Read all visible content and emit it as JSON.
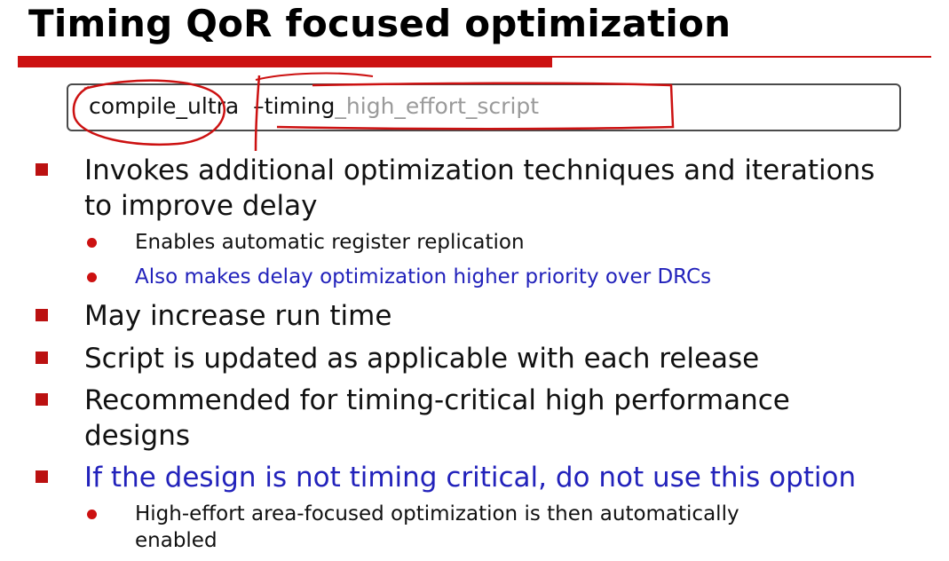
{
  "title": "Timing QoR focused optimization",
  "command": {
    "main": "compile_ultra",
    "flag": "–timing",
    "suffix": "_high_effort_script"
  },
  "bullets": [
    {
      "line1": "Invokes additional optimization techniques and iterations",
      "line2": "to improve delay"
    },
    {
      "sub1": "Enables automatic register replication"
    },
    {
      "sub2": "Also makes delay optimization higher priority over DRCs"
    },
    {
      "line1": "May increase run time"
    },
    {
      "line1": "Script is updated as applicable with each release"
    },
    {
      "line1": "Recommended for timing-critical high performance",
      "line2": "designs"
    },
    {
      "line1": "If the design is not timing critical, do not use this option"
    },
    {
      "line1": "High-effort area-focused optimization is then automatically",
      "line2": "enabled"
    }
  ],
  "colors": {
    "accent_red": "#cc1111",
    "bullet_red": "#bb1111",
    "link_blue": "#2222bb",
    "suffix_gray": "#9a9a9a"
  }
}
